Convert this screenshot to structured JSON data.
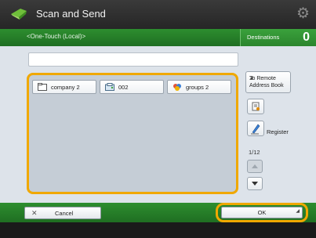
{
  "app": {
    "title": "Scan and Send"
  },
  "header": {
    "breadcrumb": "<One-Touch (Local)>",
    "destinations_label": "Destinations",
    "destinations_count": "0"
  },
  "list": {
    "items": [
      {
        "label": "company 2",
        "icon": "folder-icon"
      },
      {
        "label": "002",
        "icon": "fax-icon"
      },
      {
        "label": "groups 2",
        "icon": "group-icon"
      }
    ]
  },
  "side": {
    "remote_label": "To Remote Address Book",
    "register_label": "Register",
    "page": "1/12"
  },
  "footer": {
    "cancel_label": "Cancel",
    "ok_label": "OK"
  },
  "colors": {
    "accent": "#f0a800",
    "bar_green": "#2d8e2f"
  }
}
